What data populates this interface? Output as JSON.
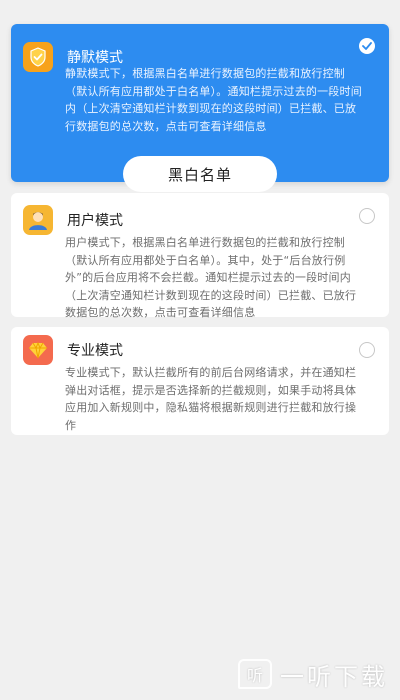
{
  "modes": [
    {
      "title": "静默模式",
      "icon": "shield-check-icon",
      "selected": true,
      "desc": "静默模式下，根据黑白名单进行数据包的拦截和放行控制（默认所有应用都处于白名单）。通知栏提示过去的一段时间内（上次清空通知栏计数到现在的这段时间）已拦截、已放行数据包的总次数，点击可查看详细信息",
      "button_label": "黑白名单"
    },
    {
      "title": "用户模式",
      "icon": "user-avatar-icon",
      "selected": false,
      "desc": "用户模式下，根据黑白名单进行数据包的拦截和放行控制（默认所有应用都处于白名单）。其中，处于“后台放行例外”的后台应用将不会拦截。通知栏提示过去的一段时间内（上次清空通知栏计数到现在的这段时间）已拦截、已放行数据包的总次数，点击可查看详细信息"
    },
    {
      "title": "专业模式",
      "icon": "diamond-icon",
      "selected": false,
      "desc": "专业模式下，默认拦截所有的前后台网络请求，并在通知栏弹出对话框，提示是否选择新的拦截规则，如果手动将具体应用加入新规则中，隐私猫将根据新规则进行拦截和放行操作"
    }
  ],
  "colors": {
    "selected_card": "#2d8cf0",
    "shield_icon_bg": "#f7a21b",
    "user_icon_bg": "#f6b632",
    "diamond_icon_bg": "#f46a4e"
  },
  "watermark": {
    "icon_glyph": "听",
    "text": "一听下载"
  }
}
